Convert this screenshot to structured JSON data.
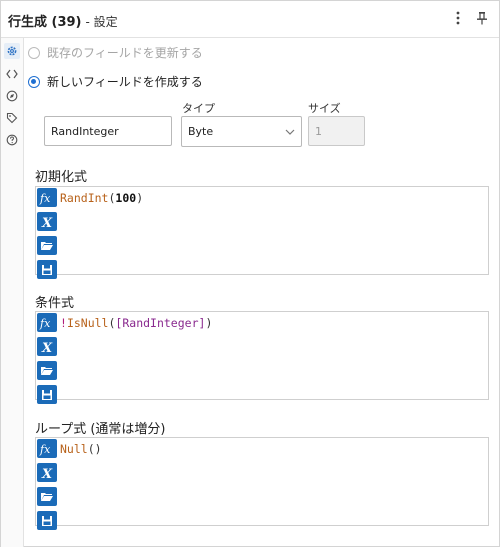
{
  "header": {
    "title": "行生成 (39)",
    "subtitle": "- 設定"
  },
  "radio_options": {
    "update_existing": "既存のフィールドを更新する",
    "create_new": "新しいフィールドを作成する"
  },
  "new_field": {
    "name_value": "RandInteger",
    "type_label": "タイプ",
    "type_value": "Byte",
    "size_label": "サイズ",
    "size_value": "1"
  },
  "sections": {
    "init": {
      "title": "初期化式",
      "expr_fn": "RandInt",
      "expr_open": "(",
      "expr_arg": "100",
      "expr_close": ")"
    },
    "condition": {
      "title": "条件式",
      "expr_op": "!",
      "expr_fn": "IsNull",
      "expr_open": "(",
      "expr_field": "[RandInteger]",
      "expr_close": ")"
    },
    "loop": {
      "title": "ループ式 (通常は増分)",
      "expr_fn": "Null",
      "expr_paren": "()"
    }
  },
  "icons": {
    "sidebar": [
      "gear-icon",
      "code-icon",
      "compass-icon",
      "tag-icon",
      "help-icon"
    ],
    "editor_tools": [
      "fx-icon",
      "variable-icon",
      "open-folder-icon",
      "save-icon"
    ]
  },
  "colors": {
    "accent": "#1f6fd1",
    "tool_button": "#1b6bb8",
    "function_text": "#b8621b",
    "field_text": "#8a2a8f"
  }
}
